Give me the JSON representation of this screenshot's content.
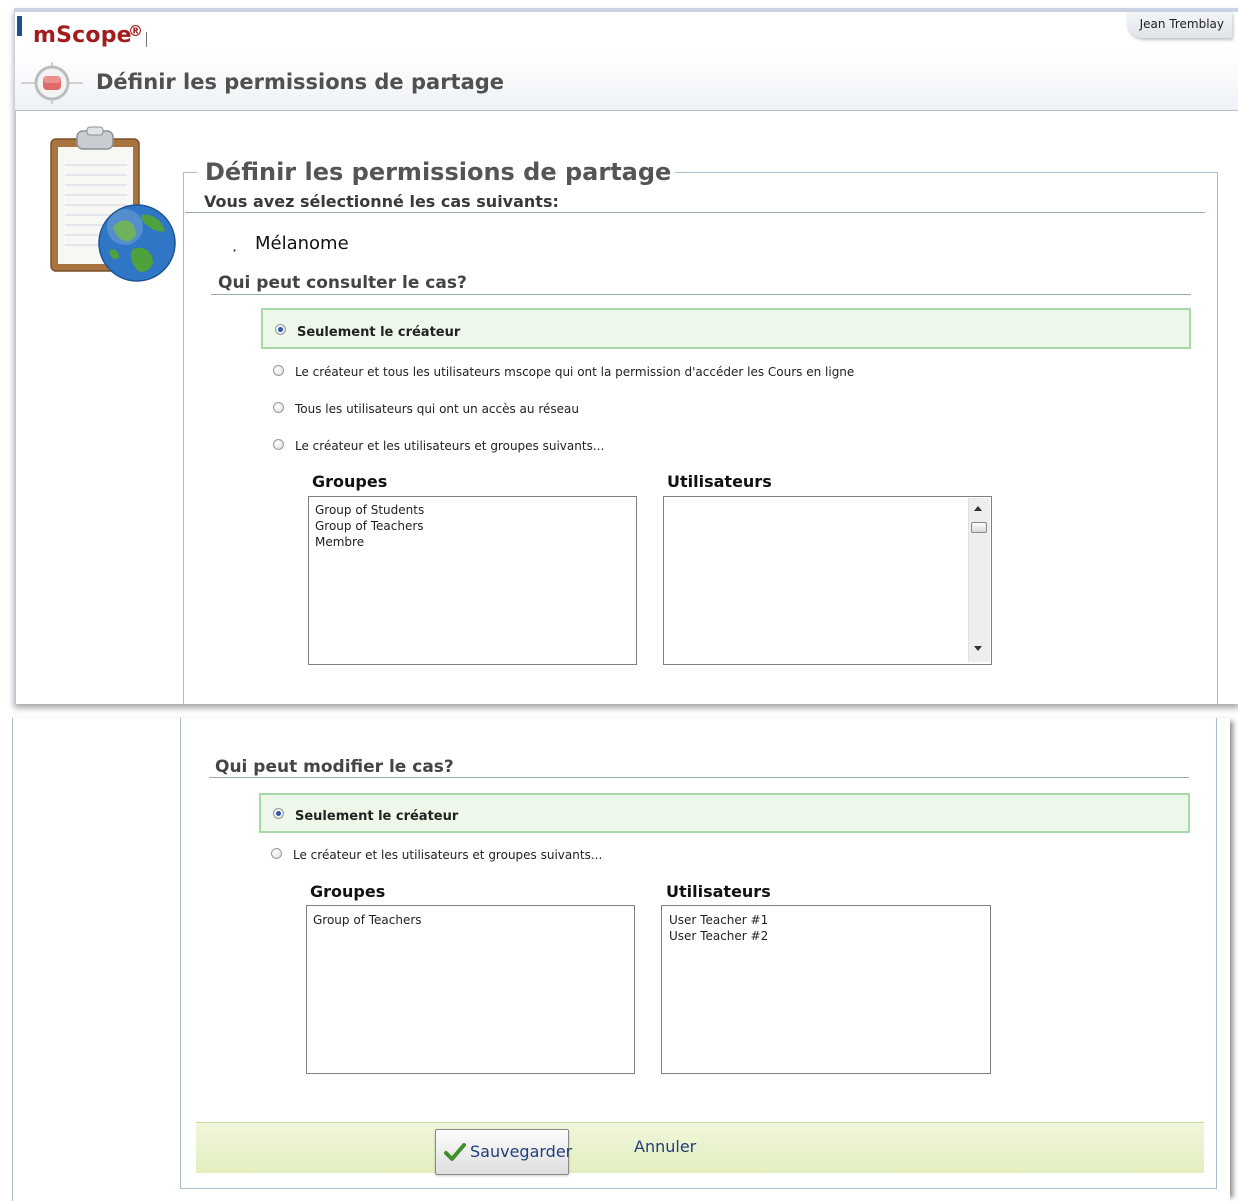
{
  "app": {
    "brand": "mScope",
    "brand_symbol": "®",
    "user": "Jean Tremblay"
  },
  "header": {
    "title": "Définir les permissions de partage"
  },
  "form": {
    "title": "Définir les permissions de partage",
    "selected_cases_label": "Vous avez sélectionné les cas suivants:",
    "cases": [
      "Mélanome"
    ],
    "bullet": "·"
  },
  "view_section": {
    "title": "Qui peut consulter le cas?",
    "options": [
      {
        "label": "Seulement le créateur",
        "selected": true
      },
      {
        "label": "Le créateur et tous les utilisateurs mscope qui ont la permission d'accéder les Cours en ligne",
        "selected": false
      },
      {
        "label": "Tous les utilisateurs qui ont un accès au réseau",
        "selected": false
      },
      {
        "label": "Le créateur et les utilisateurs et groupes suivants...",
        "selected": false
      }
    ],
    "groups_header": "Groupes",
    "users_header": "Utilisateurs",
    "groups": [
      "Group of Students",
      "Group of Teachers",
      "Membre"
    ],
    "users": []
  },
  "edit_section": {
    "title": "Qui peut modifier le cas?",
    "options": [
      {
        "label": "Seulement le créateur",
        "selected": true
      },
      {
        "label": "Le créateur et les utilisateurs et groupes suivants...",
        "selected": false
      }
    ],
    "groups_header": "Groupes",
    "users_header": "Utilisateurs",
    "groups": [
      "Group of Teachers"
    ],
    "users": [
      "User Teacher #1",
      "User Teacher #2"
    ]
  },
  "actions": {
    "save_label": "Sauvegarder",
    "cancel_label": "Annuler"
  },
  "colors": {
    "brand": "#a11c1c",
    "selected_option_bg": "#eef8ea",
    "selected_option_border": "#a8d8a8",
    "action_bar": "#e3efbf",
    "link": "#1f3f7a"
  }
}
